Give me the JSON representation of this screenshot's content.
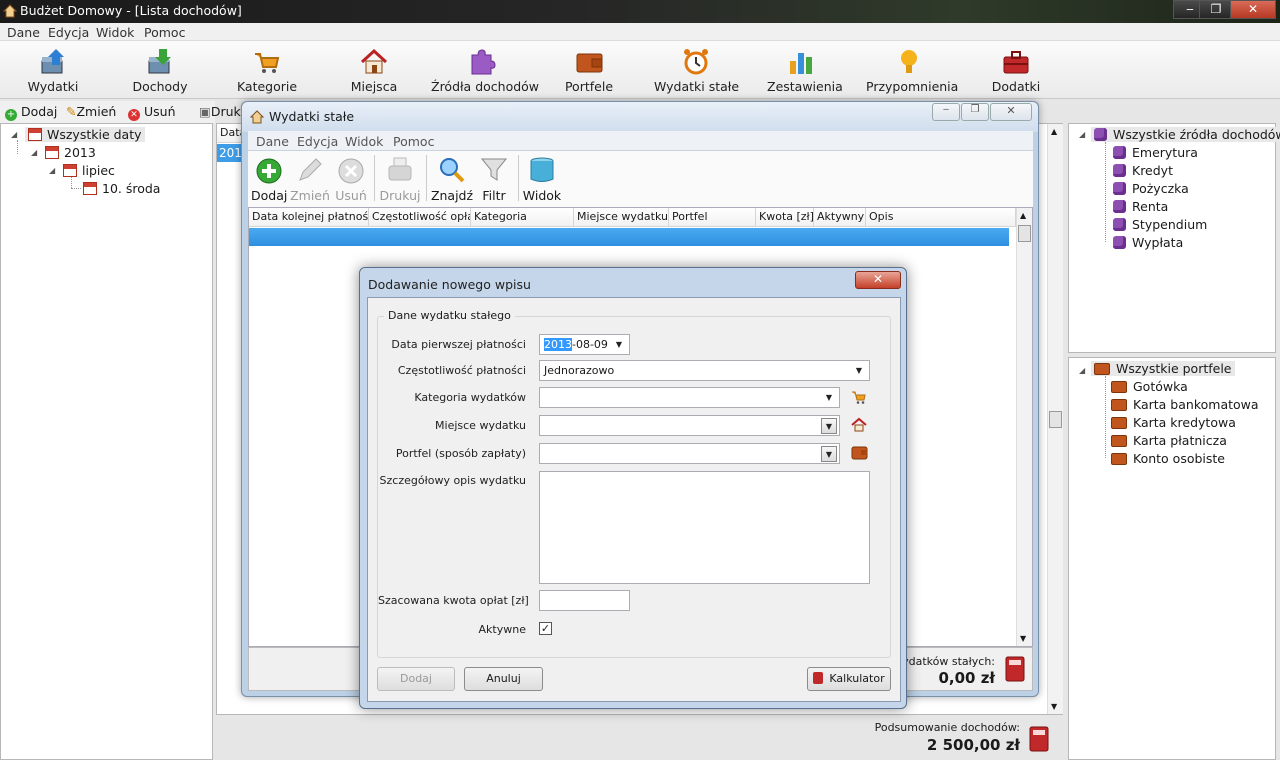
{
  "app": {
    "title": "Budżet Domowy - [Lista dochodów]",
    "win_min": "‒",
    "win_max": "❐",
    "win_close": "✕"
  },
  "menu": [
    "Dane",
    "Edycja",
    "Widok",
    "Pomoc"
  ],
  "toolbar": [
    {
      "label": "Wydatki",
      "icon": "expenses-icon"
    },
    {
      "label": "Dochody",
      "icon": "income-icon"
    },
    {
      "label": "Kategorie",
      "icon": "cart-icon"
    },
    {
      "label": "Miejsca",
      "icon": "house-icon"
    },
    {
      "label": "Źródła dochodów",
      "icon": "puzzle-icon"
    },
    {
      "label": "Portfele",
      "icon": "wallet-icon"
    },
    {
      "label": "Wydatki stałe",
      "icon": "alarm-clock-icon"
    },
    {
      "label": "Zestawienia",
      "icon": "bar-chart-icon"
    },
    {
      "label": "Przypomnienia",
      "icon": "lightbulb-icon"
    },
    {
      "label": "Dodatki",
      "icon": "toolbox-icon"
    }
  ],
  "subtoolbar": {
    "add": "Dodaj",
    "edit": "Zmień",
    "delete": "Usuń",
    "print": "Druk"
  },
  "date_tree": {
    "root": "Wszystkie daty",
    "year": "2013",
    "month": "lipiec",
    "day": "10. środa"
  },
  "income_grid": {
    "col0": "Data",
    "row0": "201"
  },
  "sources": {
    "root": "Wszystkie źródła dochodów",
    "items": [
      "Emerytura",
      "Kredyt",
      "Pożyczka",
      "Renta",
      "Stypendium",
      "Wypłata"
    ]
  },
  "wallets": {
    "root": "Wszystkie portfele",
    "items": [
      "Gotówka",
      "Karta bankomatowa",
      "Karta kredytowa",
      "Karta płatnicza",
      "Konto osobiste"
    ]
  },
  "income_summary": {
    "label": "Podsumowanie dochodów:",
    "value": "2 500,00",
    "currency": "zł"
  },
  "recurring": {
    "title": "Wydatki stałe",
    "menu": [
      "Dane",
      "Edycja",
      "Widok",
      "Pomoc"
    ],
    "tools": [
      {
        "label": "Dodaj",
        "icon": "add-icon",
        "enabled": true
      },
      {
        "label": "Zmień",
        "icon": "pencil-icon",
        "enabled": false
      },
      {
        "label": "Usuń",
        "icon": "delete-icon",
        "enabled": false
      },
      {
        "label": "Drukuj",
        "icon": "printer-icon",
        "enabled": false
      },
      {
        "label": "Znajdź",
        "icon": "magnifier-icon",
        "enabled": true
      },
      {
        "label": "Filtr",
        "icon": "funnel-icon",
        "enabled": true
      },
      {
        "label": "Widok",
        "icon": "view-icon",
        "enabled": true
      }
    ],
    "columns": [
      "Data kolejnej płatności",
      "Częstotliwość opłat",
      "Kategoria",
      "Miejsce wydatku",
      "Portfel",
      "Kwota [zł]",
      "Aktywny",
      "Opis"
    ],
    "summary_label": "wydatków stałych:",
    "summary_value": "0,00",
    "currency": "zł"
  },
  "dialog": {
    "title": "Dodawanie nowego wpisu",
    "group": "Dane wydatku stałego",
    "labels": {
      "first_date": "Data pierwszej płatności",
      "frequency": "Częstotliwość płatności",
      "category": "Kategoria wydatków",
      "place": "Miejsce wydatku",
      "wallet": "Portfel (sposób zapłaty)",
      "description": "Szczegółowy opis wydatku",
      "amount": "Szacowana kwota opłat [zł]",
      "active": "Aktywne"
    },
    "values": {
      "date_sel": "2013",
      "date_rest": "-08-09",
      "frequency": "Jednorazowo",
      "category": "",
      "place": "",
      "wallet": "",
      "description": "",
      "amount": "",
      "active": true
    },
    "buttons": {
      "add": "Dodaj",
      "cancel": "Anuluj",
      "calculator": "Kalkulator"
    }
  }
}
